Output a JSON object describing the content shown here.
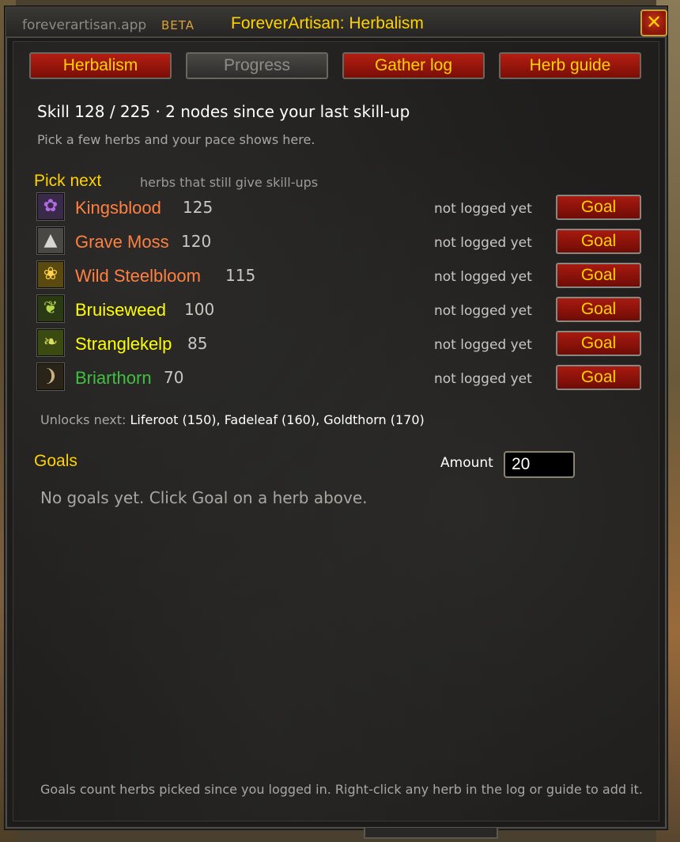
{
  "header": {
    "app_name": "foreverartisan.app",
    "badge": "BETA",
    "title": "ForeverArtisan: Herbalism",
    "close_glyph": "✕"
  },
  "tabs": [
    {
      "label": "Herbalism",
      "state": "active"
    },
    {
      "label": "Progress",
      "state": "inactive"
    },
    {
      "label": "Gather log",
      "state": "active"
    },
    {
      "label": "Herb guide",
      "state": "active"
    }
  ],
  "skill": {
    "summary": "Skill 128 / 225  ·  2 nodes since your last skill-up",
    "pace_hint": "Pick a few herbs and your pace shows here."
  },
  "pick_next": {
    "heading": "Pick next",
    "subheading": "herbs that still give skill-ups",
    "herbs": [
      {
        "name": "Kingsblood",
        "level": "125",
        "status": "not logged yet",
        "button": "Goal",
        "color": "#ff8040",
        "icon": "kingsblood-icon",
        "glyph": "✿",
        "icon_bg": "#3a2a4a",
        "icon_fg": "#b26ae0"
      },
      {
        "name": "Grave Moss",
        "level": "120",
        "status": "not logged yet",
        "button": "Goal",
        "color": "#ff8040",
        "icon": "grave-moss-icon",
        "glyph": "▲",
        "icon_bg": "#4a4844",
        "icon_fg": "#d8d6d0"
      },
      {
        "name": "Wild Steelbloom",
        "level": "115",
        "status": "not logged yet",
        "button": "Goal",
        "color": "#ff8040",
        "icon": "wild-steelbloom-icon",
        "glyph": "❀",
        "icon_bg": "#5a4a10",
        "icon_fg": "#ffd24a"
      },
      {
        "name": "Bruiseweed",
        "level": "100",
        "status": "not logged yet",
        "button": "Goal",
        "color": "#ffff00",
        "icon": "bruiseweed-icon",
        "glyph": "❦",
        "icon_bg": "#2a3a14",
        "icon_fg": "#b8d84a"
      },
      {
        "name": "Stranglekelp",
        "level": "85",
        "status": "not logged yet",
        "button": "Goal",
        "color": "#ffff00",
        "icon": "stranglekelp-icon",
        "glyph": "❧",
        "icon_bg": "#3a4a10",
        "icon_fg": "#d8e060"
      },
      {
        "name": "Briarthorn",
        "level": "70",
        "status": "not logged yet",
        "button": "Goal",
        "color": "#40c040",
        "icon": "briarthorn-icon",
        "glyph": "❩",
        "icon_bg": "#2a2418",
        "icon_fg": "#c8b080"
      }
    ],
    "unlocks_label": "Unlocks next:",
    "unlocks_value": "Liferoot (150), Fadeleaf (160), Goldthorn (170)"
  },
  "goals": {
    "heading": "Goals",
    "amount_label": "Amount",
    "amount_value": "20",
    "empty_text": "No goals yet. Click Goal on a herb above."
  },
  "footer": {
    "note": "Goals count herbs picked since you logged in. Right-click any herb in the log or guide to add it."
  }
}
